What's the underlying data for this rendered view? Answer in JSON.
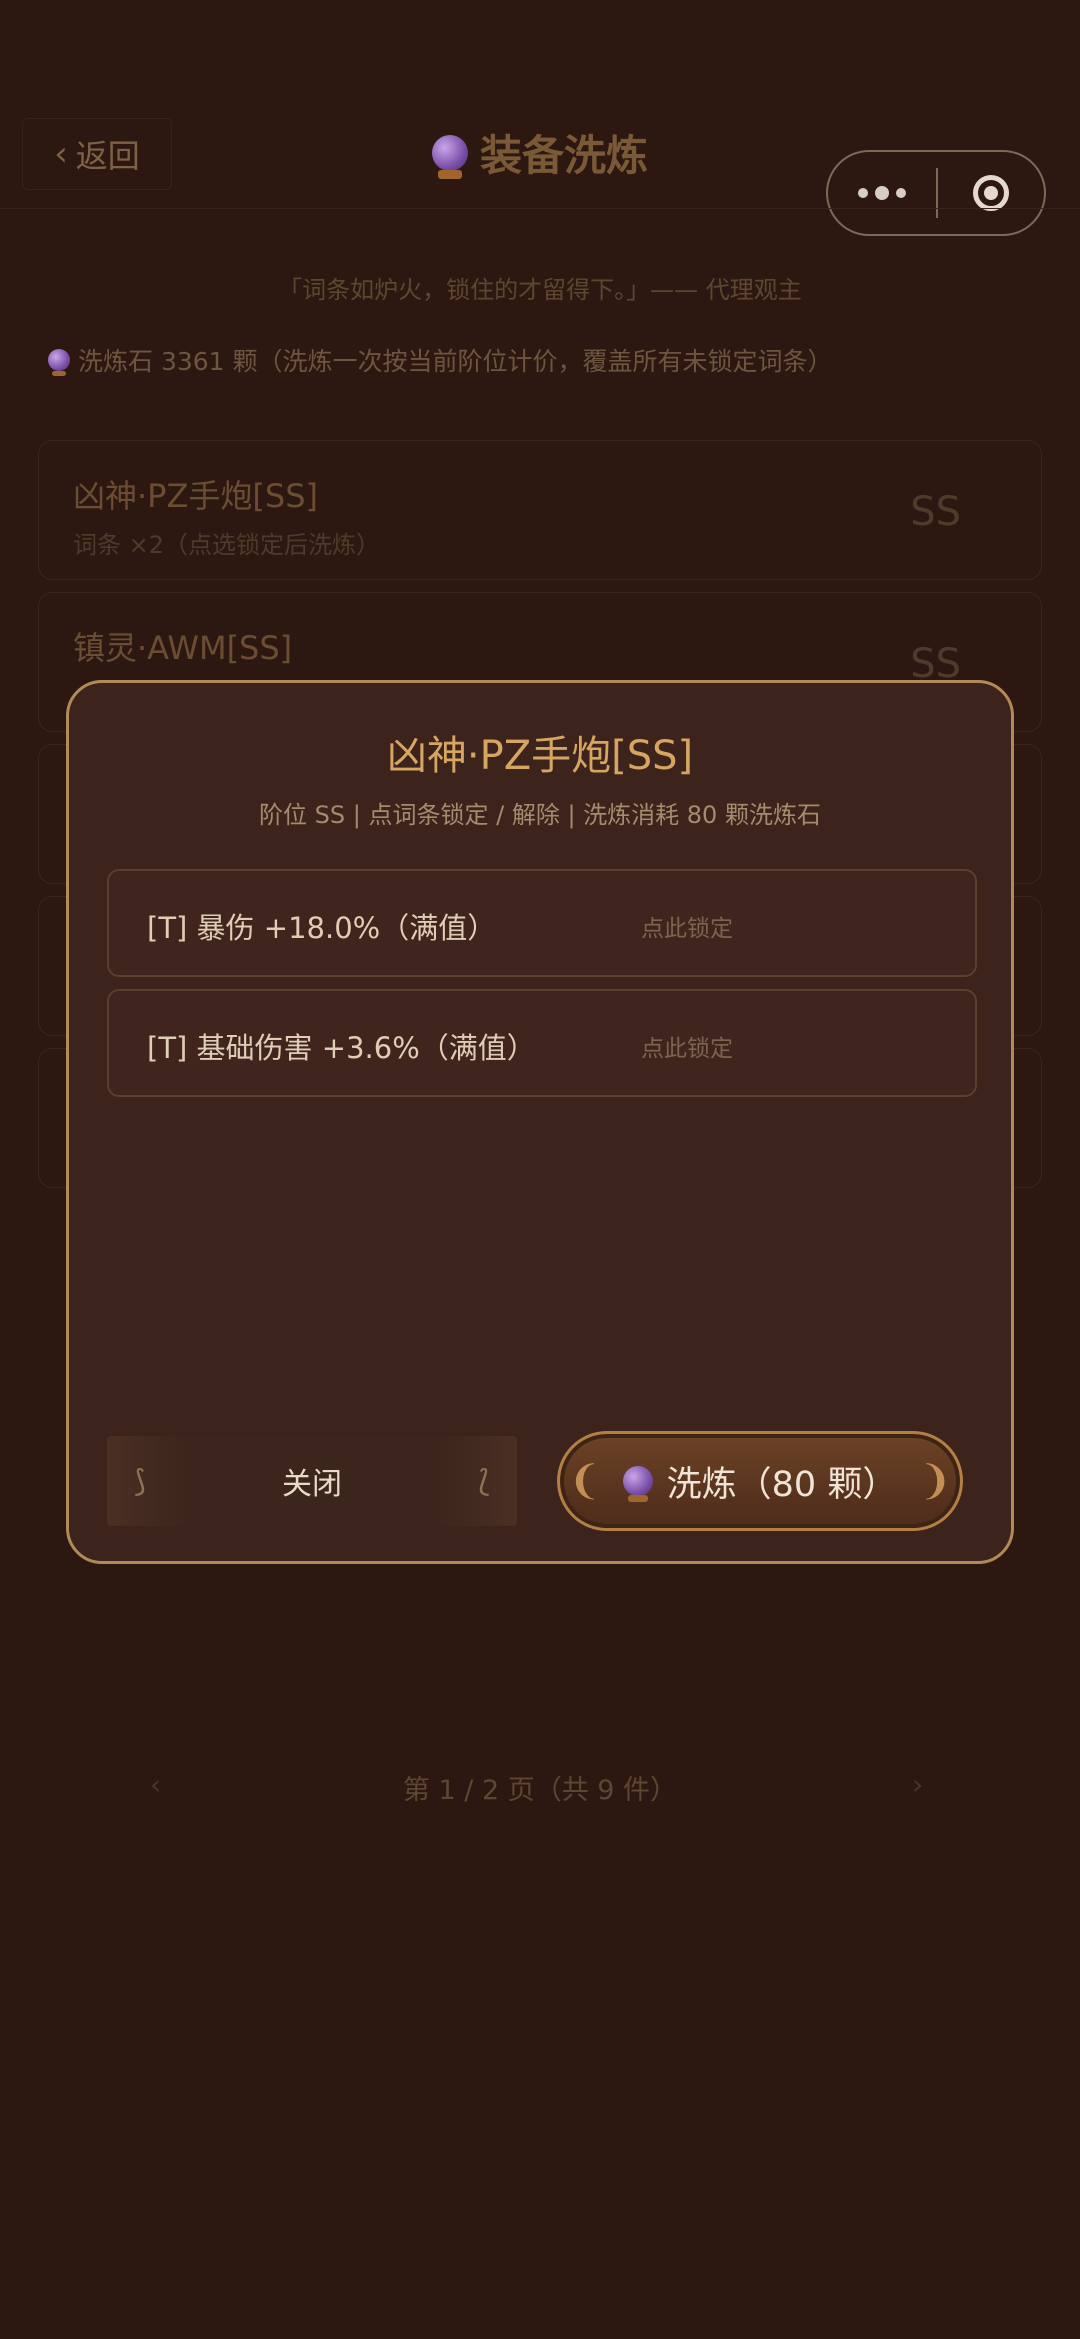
{
  "header": {
    "back_label": "返回",
    "title": "装备洗炼"
  },
  "quote": "「词条如炉火，锁住的才留得下。」—— 代理观主",
  "stone_info": "洗炼石 3361 颗（洗炼一次按当前阶位计价，覆盖所有未锁定词条）",
  "equipment_list": [
    {
      "name": "凶神·PZ手炮[SS]",
      "sub": "词条 ×2（点选锁定后洗炼）",
      "rank": "SS"
    },
    {
      "name": "镇灵·AWM[SS]",
      "sub": "",
      "rank": "SS"
    }
  ],
  "pagination": {
    "text": "第 1 / 2 页（共 9 件）",
    "prev_icon": "‹",
    "next_icon": "›"
  },
  "modal": {
    "title": "凶神·PZ手炮[SS]",
    "subtitle": "阶位 SS  |  点词条锁定 / 解除  |  洗炼消耗 80 颗洗炼石",
    "affixes": [
      {
        "text": "[T] 暴伤 +18.0%（满值）",
        "lock_hint": "点此锁定"
      },
      {
        "text": "[T] 基础伤害 +3.6%（满值）",
        "lock_hint": "点此锁定"
      }
    ],
    "close_label": "关闭",
    "refine_label": "洗炼（80 颗）"
  },
  "colors": {
    "background": "#2d1811",
    "modal_border": "#b08b57",
    "modal_title": "#d6a562"
  }
}
